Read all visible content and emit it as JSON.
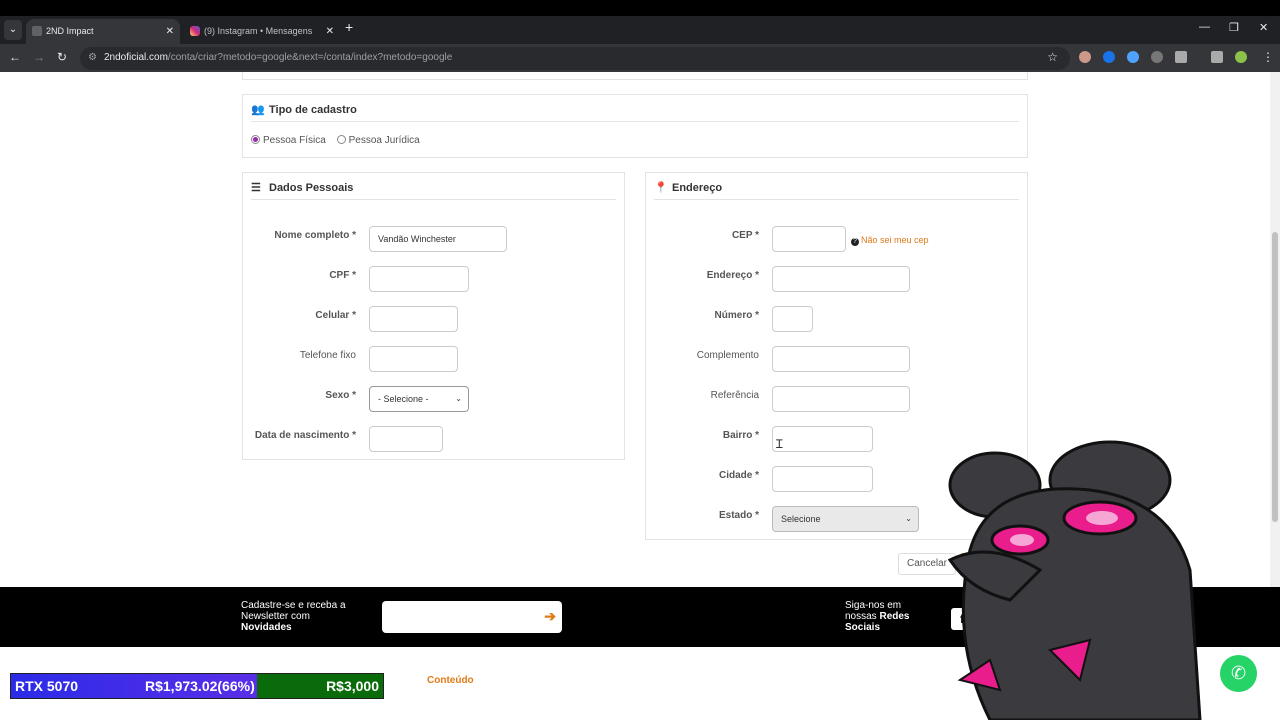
{
  "browser": {
    "tabs": [
      {
        "title": "2ND Impact",
        "active": true
      },
      {
        "title": "(9) Instagram • Mensagens",
        "active": false
      }
    ],
    "new_tab": "+",
    "url_host": "2ndoficial.com",
    "url_path": "/conta/criar?metodo=google&next=/conta/index?metodo=google",
    "window_controls": [
      "—",
      "❐",
      "✕"
    ]
  },
  "tipo_cadastro": {
    "title": "Tipo de cadastro",
    "options": [
      "Pessoa Física",
      "Pessoa Jurídica"
    ],
    "selected": "Pessoa Física"
  },
  "dados_pessoais": {
    "title": "Dados Pessoais",
    "fields": {
      "nome": {
        "label": "Nome completo *",
        "value": "Vandão Winchester"
      },
      "cpf": {
        "label": "CPF *",
        "value": ""
      },
      "celular": {
        "label": "Celular *",
        "value": ""
      },
      "telefone": {
        "label": "Telefone fixo",
        "value": ""
      },
      "sexo": {
        "label": "Sexo *",
        "value": "- Selecione -"
      },
      "nascimento": {
        "label": "Data de nascimento *",
        "value": ""
      }
    }
  },
  "endereco": {
    "title": "Endereço",
    "cep_help": "Não sei meu cep",
    "fields": {
      "cep": {
        "label": "CEP *",
        "value": ""
      },
      "endereco": {
        "label": "Endereço *",
        "value": ""
      },
      "numero": {
        "label": "Número *",
        "value": ""
      },
      "complemento": {
        "label": "Complemento",
        "value": ""
      },
      "referencia": {
        "label": "Referência",
        "value": ""
      },
      "bairro": {
        "label": "Bairro *",
        "value": ""
      },
      "cidade": {
        "label": "Cidade *",
        "value": ""
      },
      "estado": {
        "label": "Estado *",
        "value": "Selecione"
      }
    }
  },
  "actions": {
    "cancel": "Cancelar"
  },
  "footer": {
    "newsletter_line1": "Cadastre-se e receba a Newsletter com",
    "newsletter_bold": "Novidades",
    "social_line1": "Siga-nos em nossas",
    "social_bold": "Redes Sociais",
    "social_icons": [
      "facebook-icon",
      "youtube-icon",
      "instagram-icon"
    ]
  },
  "overlay": {
    "item": "RTX 5070",
    "raised": "R$1,973.02(66%)",
    "goal": "R$3,000",
    "progress": 0.66,
    "colors": {
      "blue": "#2b2be8",
      "green": "#0a6b0a"
    }
  },
  "bottom_nav": {
    "conteudo": "Conteúdo"
  },
  "colors": {
    "accent": "#e07b1a",
    "radio": "#9c27b0",
    "whatsapp": "#25d366"
  }
}
